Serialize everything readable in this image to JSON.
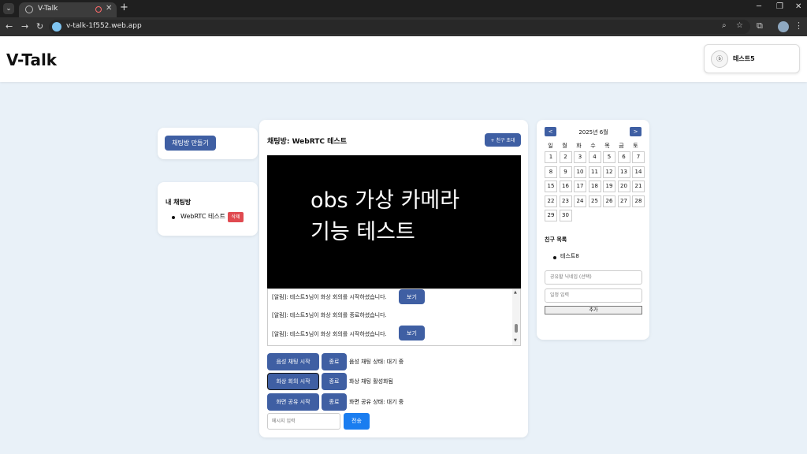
{
  "browser": {
    "tab_title": "V-Talk",
    "url": "v-talk-1f552.web.app"
  },
  "header": {
    "logo": "V-Talk",
    "user_name": "테스트5",
    "avatar_text": "ⓑ"
  },
  "sidebar": {
    "create_room_label": "채팅방 만들기",
    "my_rooms_title": "내 채팅방",
    "rooms": [
      {
        "name": "WebRTC 테스트",
        "delete_label": "삭제"
      }
    ]
  },
  "chat": {
    "title": "채팅방: WebRTC 테스트",
    "invite_label": "+ 친구 초대",
    "video_text_line1": "obs 가상 카메라",
    "video_text_line2": "기능 테스트",
    "log": [
      {
        "text": "[알림]: 테스트5님이 화상 회의를 시작하셨습니다.",
        "button": "보기"
      },
      {
        "text": "[알림]: 테스트5님이 화상 회의를 종료하셨습니다.",
        "button": ""
      },
      {
        "text": "[알림]: 테스트5님이 화상 회의를 시작하셨습니다.",
        "button": "보기"
      }
    ],
    "controls": [
      {
        "start": "음성 채팅 시작",
        "end": "종료",
        "status": "음성 채팅 상태: 대기 중"
      },
      {
        "start": "화상 회의 시작",
        "end": "종료",
        "status": "화상 채팅 활성화됨"
      },
      {
        "start": "화면 공유 시작",
        "end": "종료",
        "status": "화면 공유 상태: 대기 중"
      }
    ],
    "message_placeholder": "메시지 입력",
    "send_label": "전송"
  },
  "calendar": {
    "prev": "<",
    "next": ">",
    "title": "2025년 6월",
    "weekdays": [
      "일",
      "월",
      "화",
      "수",
      "목",
      "금",
      "토"
    ],
    "days": [
      "1",
      "2",
      "3",
      "4",
      "5",
      "6",
      "7",
      "8",
      "9",
      "10",
      "11",
      "12",
      "13",
      "14",
      "15",
      "16",
      "17",
      "18",
      "19",
      "20",
      "21",
      "22",
      "23",
      "24",
      "25",
      "26",
      "27",
      "28",
      "29",
      "30"
    ]
  },
  "friends": {
    "title": "친구 목록",
    "items": [
      "테스트8"
    ],
    "nickname_placeholder": "공유할 닉네임 (선택)",
    "schedule_placeholder": "일정 입력",
    "add_label": "추가"
  },
  "colors": {
    "primary_button": "#3f5fa3",
    "send_button": "#1a7df0",
    "delete_button": "#e04a50",
    "page_background": "#e9f1f8"
  }
}
